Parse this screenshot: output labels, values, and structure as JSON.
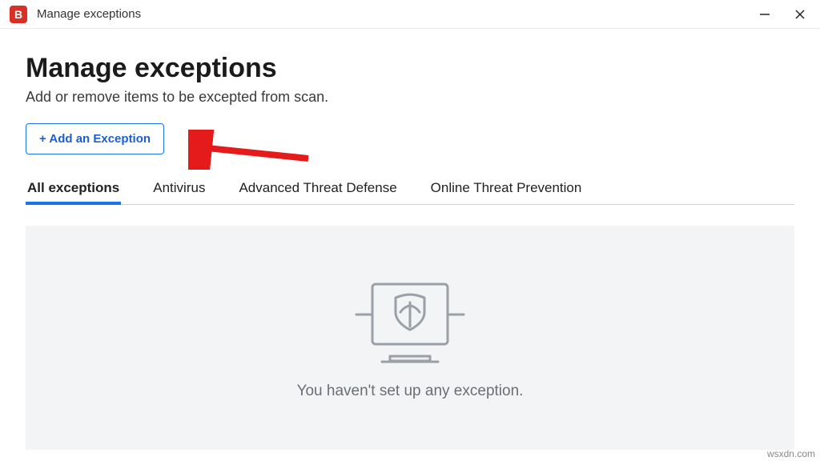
{
  "titlebar": {
    "app_icon_letter": "B",
    "title": "Manage exceptions"
  },
  "page": {
    "title": "Manage exceptions",
    "subtitle": "Add or remove items to be excepted from scan."
  },
  "actions": {
    "add_exception_label": "+ Add an Exception"
  },
  "tabs": [
    {
      "label": "All exceptions",
      "active": true
    },
    {
      "label": "Antivirus",
      "active": false
    },
    {
      "label": "Advanced Threat Defense",
      "active": false
    },
    {
      "label": "Online Threat Prevention",
      "active": false
    }
  ],
  "empty_state": {
    "message": "You haven't set up any exception."
  },
  "watermark": "wsxdn.com",
  "colors": {
    "accent": "#1a73e8",
    "brand": "#d93025",
    "panel_bg": "#f3f4f6"
  }
}
